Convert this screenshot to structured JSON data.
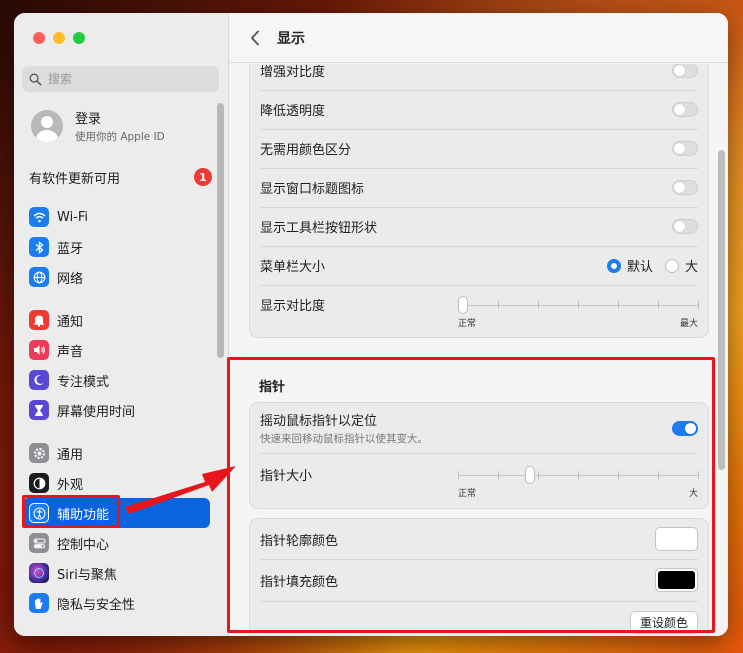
{
  "sidebar": {
    "search_placeholder": "搜索",
    "account_title": "登录",
    "account_sub": "使用你的 Apple ID",
    "updates_label": "有软件更新可用",
    "updates_badge": "1",
    "groups": [
      [
        {
          "label": "Wi-Fi",
          "icon": "wifi-icon",
          "color": "#1a7cf0"
        },
        {
          "label": "蓝牙",
          "icon": "bluetooth-icon",
          "color": "#1a7cf0"
        },
        {
          "label": "网络",
          "icon": "globe-icon",
          "color": "#1a7cf0"
        }
      ],
      [
        {
          "label": "通知",
          "icon": "bell-icon",
          "color": "#ee3a32"
        },
        {
          "label": "声音",
          "icon": "speaker-icon",
          "color": "#ee3a5a"
        },
        {
          "label": "专注模式",
          "icon": "moon-icon",
          "color": "#5a47d8"
        },
        {
          "label": "屏幕使用时间",
          "icon": "hourglass-icon",
          "color": "#5a47d8"
        }
      ],
      [
        {
          "label": "通用",
          "icon": "gear-icon",
          "color": "#8e8e93"
        },
        {
          "label": "外观",
          "icon": "appearance-icon",
          "color": "#1c1c1e"
        },
        {
          "label": "辅助功能",
          "icon": "accessibility-icon",
          "color": "#1a7cf0"
        },
        {
          "label": "控制中心",
          "icon": "control-center-icon",
          "color": "#8e8e93"
        },
        {
          "label": "Siri与聚焦",
          "icon": "siri-icon",
          "color": "#6b2fb3"
        },
        {
          "label": "隐私与安全性",
          "icon": "hand-icon",
          "color": "#1a7cf0"
        }
      ]
    ]
  },
  "main": {
    "title": "显示",
    "display_rows": [
      {
        "label": "增强对比度",
        "type": "toggle",
        "on": false
      },
      {
        "label": "降低透明度",
        "type": "toggle",
        "on": false
      },
      {
        "label": "无需用颜色区分",
        "type": "toggle",
        "on": false
      },
      {
        "label": "显示窗口标题图标",
        "type": "toggle",
        "on": false
      },
      {
        "label": "显示工具栏按钮形状",
        "type": "toggle",
        "on": false
      }
    ],
    "menubar_size": {
      "label": "菜单栏大小",
      "option_default": "默认",
      "option_large": "大",
      "selected": "默认"
    },
    "contrast": {
      "label": "显示对比度",
      "min": "正常",
      "max": "最大",
      "value": 0.0
    },
    "pointer": {
      "section_title": "指针",
      "shake_label": "摇动鼠标指针以定位",
      "shake_sub": "快速来回移动鼠标指针以使其变大。",
      "shake_on": true,
      "size_label": "指针大小",
      "size_min": "正常",
      "size_max": "大",
      "size_value": 0.3,
      "outline_label": "指针轮廓颜色",
      "outline_color": "#ffffff",
      "fill_label": "指针填充颜色",
      "fill_color": "#000000",
      "reset_label": "重设颜色"
    }
  }
}
